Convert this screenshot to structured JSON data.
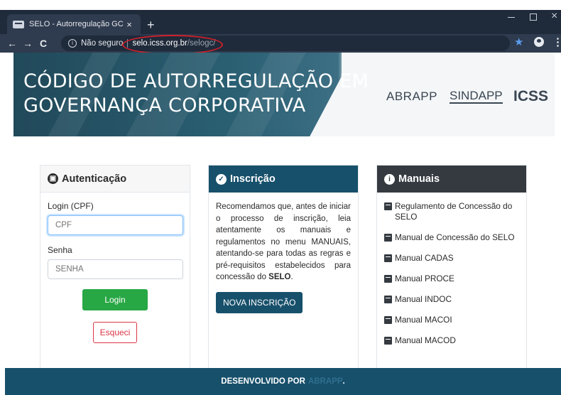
{
  "browser": {
    "tab_title": "SELO - Autorregulação GC",
    "tab_close": "×",
    "new_tab": "+",
    "back": "←",
    "forward": "→",
    "reload": "C",
    "security_label": "Não seguro",
    "url_host": "selo.icss.org.br",
    "url_path": "/selogc/",
    "window_close": "×"
  },
  "hero": {
    "title_line1": "CÓDIGO DE AUTORREGULAÇÃO EM",
    "title_line2": "GOVERNANÇA CORPORATIVA",
    "logo_abrapp": "ABRAPP",
    "logo_sindapp": "SINDAPP",
    "logo_icss": "ICSS"
  },
  "auth": {
    "title": "Autenticação",
    "login_label": "Login (CPF)",
    "login_placeholder": "CPF",
    "password_label": "Senha",
    "password_placeholder": "SENHA",
    "login_button": "Login",
    "forgot_button": "Esqueci"
  },
  "inscricao": {
    "title": "Inscrição",
    "text_before": "Recomendamos que, antes de iniciar o processo de inscrição, leia atentamente os manuais e regulamentos no menu MANUAIS, atentando-se para todas as regras e pré-requisitos estabelecidos para concessão do ",
    "text_bold": "SELO",
    "text_after": ".",
    "button": "NOVA INSCRIÇÃO"
  },
  "manuais": {
    "title": "Manuais",
    "items": [
      "Regulamento de Concessão do SELO",
      "Manual de Concessão do SELO",
      "Manual CADAS",
      "Manual PROCE",
      "Manual INDOC",
      "Manual MACOI",
      "Manual MACOD"
    ]
  },
  "footer": {
    "text": "DESENVOLVIDO POR",
    "brand": "ABRAPP",
    "end": "."
  },
  "colors": {
    "brand_blue": "#17506b",
    "login_green": "#28a745",
    "forgot_red": "#dc3545",
    "manuais_dark": "#343a40"
  }
}
